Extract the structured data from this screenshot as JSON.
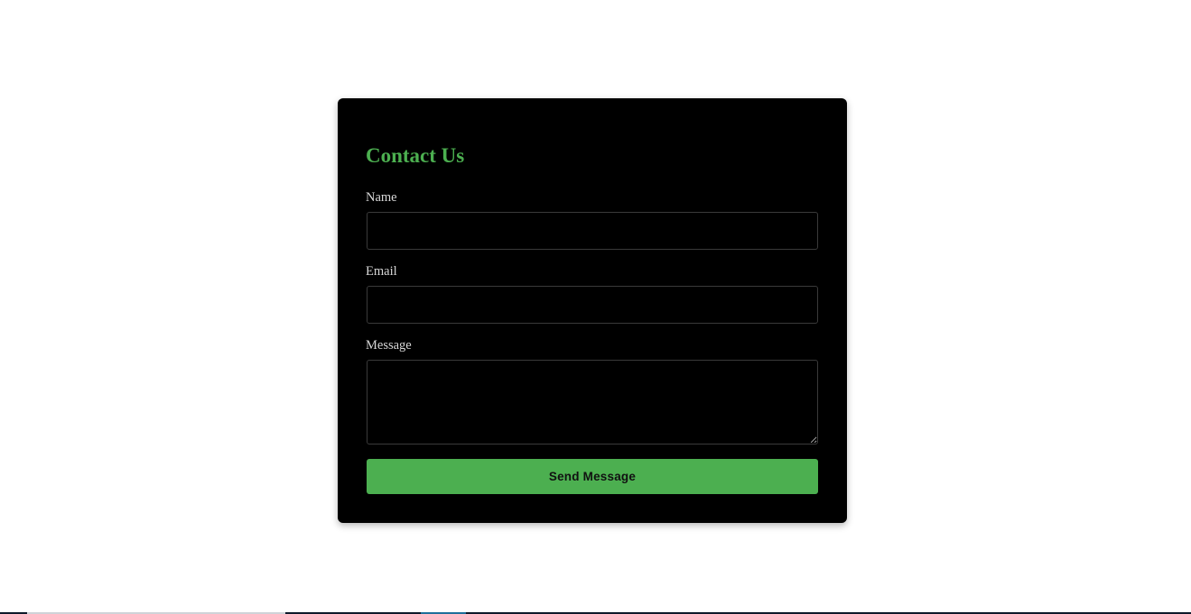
{
  "form": {
    "title": "Contact Us",
    "fields": [
      {
        "label": "Name",
        "value": "",
        "placeholder": ""
      },
      {
        "label": "Email",
        "value": "",
        "placeholder": ""
      },
      {
        "label": "Message",
        "value": "",
        "placeholder": ""
      }
    ],
    "submit_label": "Send Message"
  },
  "colors": {
    "accent": "#4caf50",
    "card_background": "#000000",
    "page_background": "#ffffff"
  }
}
